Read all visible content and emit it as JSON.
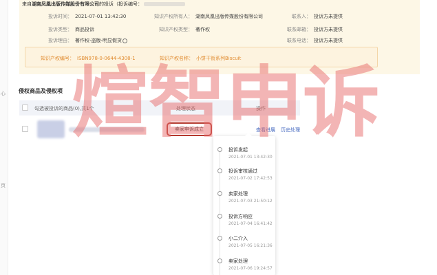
{
  "header": {
    "from_label": "来自",
    "company": "湖南凤凰出版传媒股份有限公司",
    "complaint_label": "的投诉（投诉编号：",
    "complaint_id_masked": ""
  },
  "info": {
    "time_label": "投诉时间：",
    "time_value": "2021-07-01 13:42:30",
    "type_label": "投诉类型：",
    "type_value": "商品投诉",
    "reason_label": "投诉理由：",
    "reason_value": "著作权-盗版-明显假货",
    "owner_label": "知识产权所有人：",
    "owner_value": "湖南凤凰出版传媒股份有限公司",
    "ip_type_label": "知识产权类型：",
    "ip_type_value": "著作权",
    "contact_label": "联系人：",
    "contact_value": "投诉方未提供",
    "email_label": "联系邮箱：",
    "email_value": "投诉方未提供",
    "phone_label": "联系电话：",
    "phone_value": "投诉方未提供"
  },
  "ip": {
    "id_label": "知识产权编号：",
    "id_value": "ISBN978-0-0644-4308-1",
    "name_label": "知识产权名称：",
    "name_value": "小饼干街系列Biscuit"
  },
  "section": {
    "title": "侵权商品及侵权项"
  },
  "table": {
    "col_goods": "勾选被投诉的商品(0),共1个",
    "col_status": "处理状态",
    "col_action": "操作",
    "row_status": "卖家申诉成立",
    "row_view": "查看进展",
    "row_history": "历史处理"
  },
  "timeline": [
    {
      "title": "投诉发起",
      "time": "2021-07-01 13:42:30"
    },
    {
      "title": "投诉审核通过",
      "time": "2021-07-02 17:42:53"
    },
    {
      "title": "卖家处理",
      "time": "2021-07-03 21:50:12"
    },
    {
      "title": "投诉方响应",
      "time": "2021-07-04 16:41:42"
    },
    {
      "title": "小二介入",
      "time": "2021-07-05 16:21:36"
    },
    {
      "title": "卖家处理",
      "time": "2021-07-06 19:24:57"
    }
  ],
  "sidebar": {
    "mark_1": "心",
    "mark_2": "页"
  },
  "watermark": {
    "text": "煊智申诉"
  },
  "colors": {
    "accent_orange": "#e08a2e",
    "link_blue": "#4b6ec2",
    "highlight_red": "#b5392e",
    "watermark_red": "#e86c6c"
  }
}
